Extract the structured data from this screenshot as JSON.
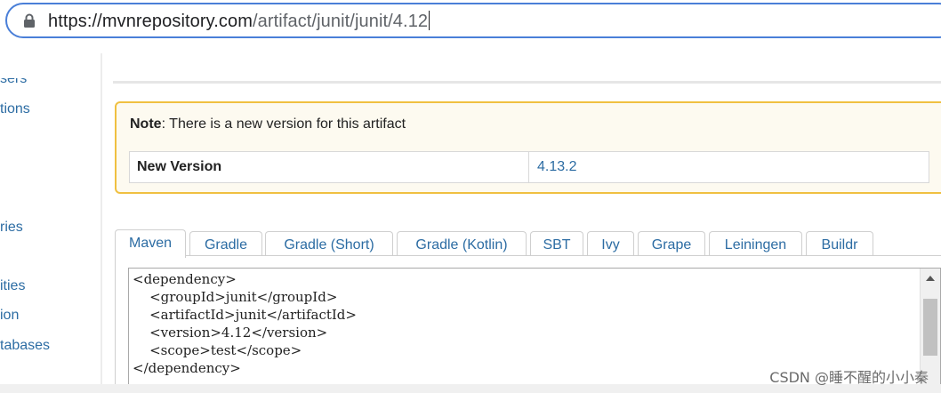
{
  "browser": {
    "url_host": "https://mvnrepository.com",
    "url_path": "/artifact/junit/junit/4.12"
  },
  "sidebar": {
    "items": [
      "sers",
      "tions",
      "ries",
      "ities",
      "ion",
      "tabases"
    ]
  },
  "note": {
    "label": "Note",
    "message": ": There is a new version for this artifact",
    "row_label": "New Version",
    "row_value": "4.13.2"
  },
  "tabs": [
    {
      "label": "Maven",
      "active": true
    },
    {
      "label": "Gradle",
      "active": false
    },
    {
      "label": "Gradle (Short)",
      "active": false
    },
    {
      "label": "Gradle (Kotlin)",
      "active": false
    },
    {
      "label": "SBT",
      "active": false
    },
    {
      "label": "Ivy",
      "active": false
    },
    {
      "label": "Grape",
      "active": false
    },
    {
      "label": "Leiningen",
      "active": false
    },
    {
      "label": "Buildr",
      "active": false
    }
  ],
  "code": {
    "lines": [
      "<dependency>",
      "    <groupId>junit</groupId>",
      "    <artifactId>junit</artifactId>",
      "    <version>4.12</version>",
      "    <scope>test</scope>",
      "</dependency>"
    ]
  },
  "watermark": "CSDN @睡不醒的小小秦",
  "colors": {
    "link": "#2c6ca3",
    "note_border": "#f0c040",
    "url_border": "#4a7fd8"
  }
}
